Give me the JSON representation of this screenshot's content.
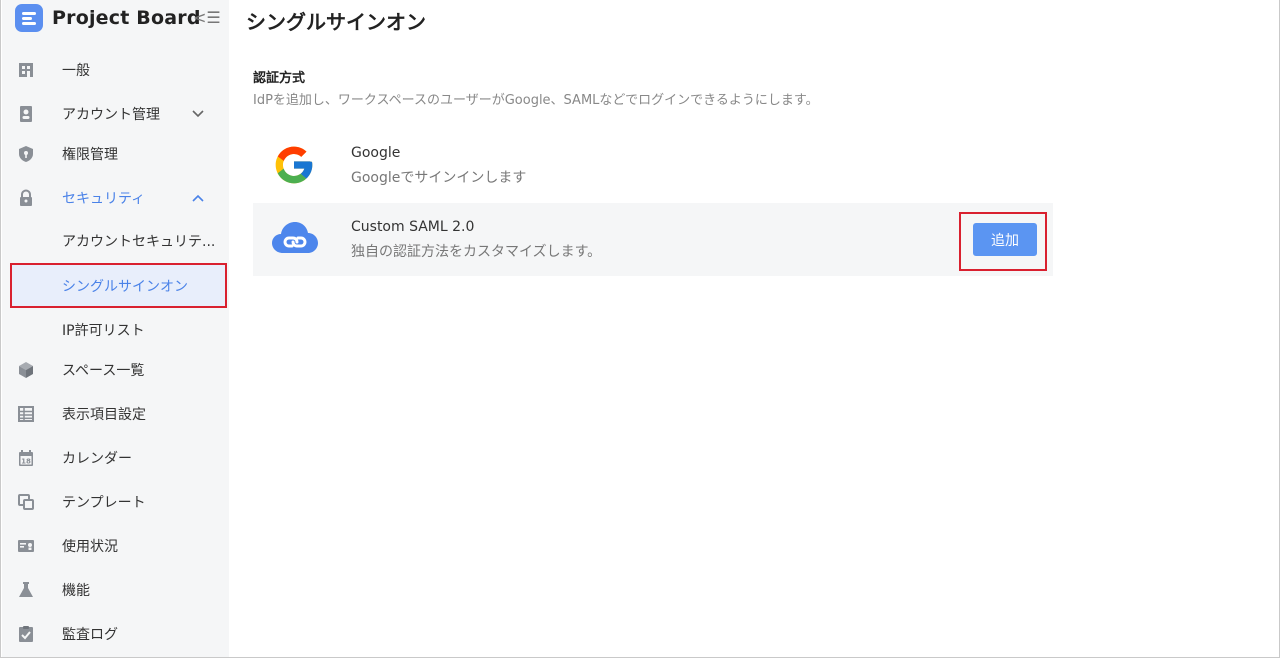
{
  "app": {
    "name": "Project Board"
  },
  "page": {
    "title": "シングルサインオン",
    "section_title": "認証方式",
    "section_desc": "IdPを追加し、ワークスペースのユーザーがGoogle、SAMLなどでログインできるようにします。"
  },
  "sidebar": {
    "items": [
      {
        "label": "一般",
        "icon": "building-icon"
      },
      {
        "label": "アカウント管理",
        "icon": "contact-card-icon",
        "chevron": "down"
      },
      {
        "label": "権限管理",
        "icon": "shield-icon"
      },
      {
        "label": "セキュリティ",
        "icon": "lock-icon",
        "chevron": "up",
        "expanded": true
      },
      {
        "label": "スペース一覧",
        "icon": "cube-icon"
      },
      {
        "label": "表示項目設定",
        "icon": "table-icon"
      },
      {
        "label": "カレンダー",
        "icon": "calendar-icon",
        "icon_text": "18"
      },
      {
        "label": "テンプレート",
        "icon": "copy-icon"
      },
      {
        "label": "使用状況",
        "icon": "usage-icon"
      },
      {
        "label": "機能",
        "icon": "flask-icon"
      },
      {
        "label": "監査ログ",
        "icon": "clipboard-check-icon"
      }
    ],
    "security_subitems": [
      {
        "label": "アカウントセキュリテ..."
      },
      {
        "label": "シングルサインオン",
        "selected": true
      },
      {
        "label": "IP許可リスト"
      }
    ]
  },
  "providers": [
    {
      "name": "Google",
      "desc": "Googleでサインインします",
      "icon": "google-icon"
    },
    {
      "name": "Custom SAML 2.0",
      "desc": "独自の認証方法をカスタマイズします。",
      "icon": "cloud-link-icon",
      "action_label": "追加"
    }
  ],
  "colors": {
    "accent": "#4a82e8",
    "button": "#5b95f2",
    "highlight_border": "#d9202f",
    "sidebar_bg": "#f5f6f7"
  }
}
